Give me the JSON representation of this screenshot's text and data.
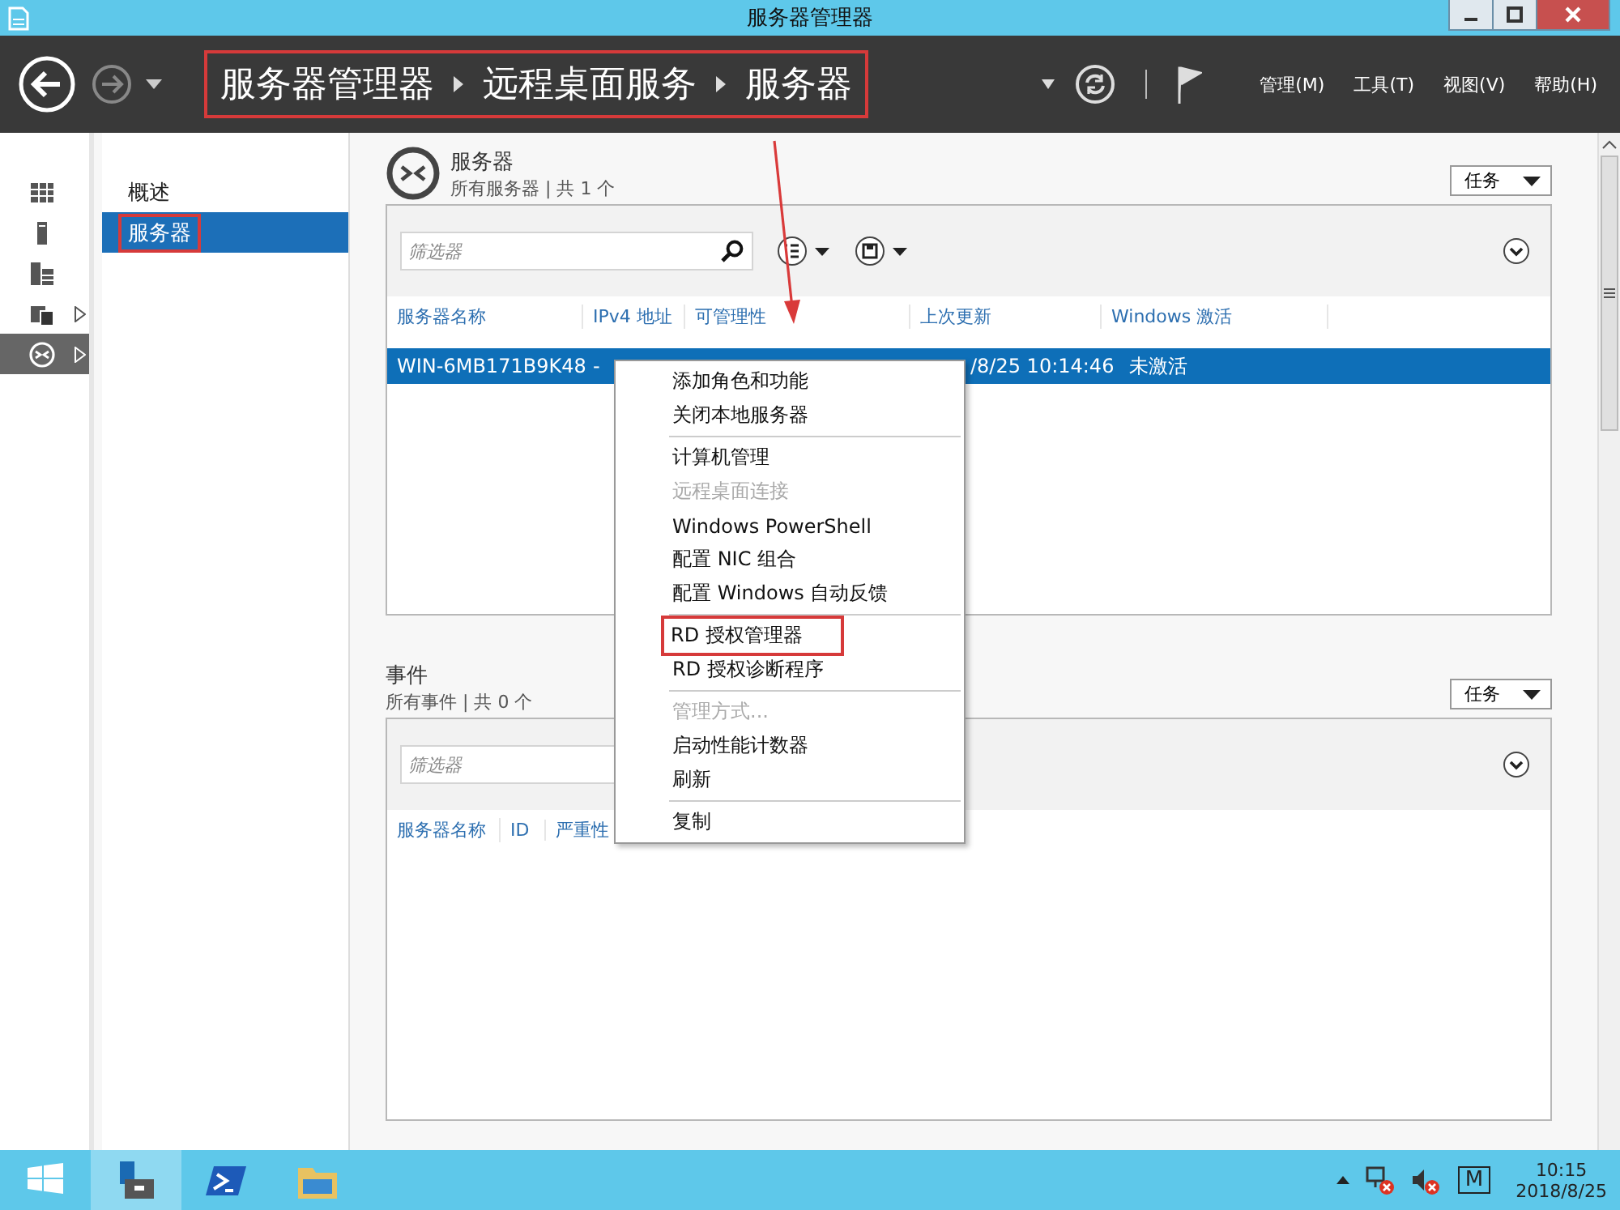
{
  "window": {
    "title": "服务器管理器"
  },
  "header": {
    "breadcrumb": [
      {
        "label": "服务器管理器"
      },
      {
        "label": "远程桌面服务"
      },
      {
        "label": "服务器"
      }
    ],
    "breadcrumb_annotated": true,
    "menus": [
      {
        "label": "管理(M)"
      },
      {
        "label": "工具(T)"
      },
      {
        "label": "视图(V)"
      },
      {
        "label": "帮助(H)"
      }
    ]
  },
  "rail": [
    {
      "selected": false,
      "expandable": false
    },
    {
      "selected": false,
      "expandable": false
    },
    {
      "selected": false,
      "expandable": false
    },
    {
      "selected": false,
      "expandable": true
    },
    {
      "selected": true,
      "expandable": true
    }
  ],
  "nav": [
    {
      "label": "概述",
      "selected": false,
      "annotated": false
    },
    {
      "label": "服务器",
      "selected": true,
      "annotated": true
    }
  ],
  "servers": {
    "title": "服务器",
    "subtitle": "所有服务器 | 共 1 个",
    "tasks": "任务",
    "filter": {
      "placeholder": "筛选器"
    },
    "columns": [
      "服务器名称",
      "IPv4 地址",
      "可管理性",
      "上次更新",
      "Windows 激活"
    ],
    "rows": [
      {
        "cells": [
          "WIN-6MB171B9K48",
          "-",
          "",
          "/8/25 10:14:46",
          "未激活"
        ],
        "selected": true
      }
    ]
  },
  "events": {
    "title": "事件",
    "subtitle": "所有事件 | 共 0 个",
    "tasks": "任务",
    "filter": {
      "placeholder": "筛选器"
    },
    "columns": [
      "服务器名称",
      "ID",
      "严重性"
    ]
  },
  "context_menu": [
    {
      "kind": "item",
      "label": "添加角色和功能",
      "disabled": false,
      "annotated": false
    },
    {
      "kind": "item",
      "label": "关闭本地服务器",
      "disabled": false,
      "annotated": false
    },
    {
      "kind": "separator"
    },
    {
      "kind": "item",
      "label": "计算机管理",
      "disabled": false,
      "annotated": false
    },
    {
      "kind": "item",
      "label": "远程桌面连接",
      "disabled": true,
      "annotated": false
    },
    {
      "kind": "item",
      "label": "Windows PowerShell",
      "disabled": false,
      "annotated": false
    },
    {
      "kind": "item",
      "label": "配置 NIC 组合",
      "disabled": false,
      "annotated": false
    },
    {
      "kind": "item",
      "label": "配置 Windows 自动反馈",
      "disabled": false,
      "annotated": false
    },
    {
      "kind": "separator"
    },
    {
      "kind": "item",
      "label": "RD 授权管理器",
      "disabled": false,
      "annotated": true
    },
    {
      "kind": "item",
      "label": "RD 授权诊断程序",
      "disabled": false,
      "annotated": false
    },
    {
      "kind": "separator"
    },
    {
      "kind": "item",
      "label": "管理方式...",
      "disabled": true,
      "annotated": false
    },
    {
      "kind": "item",
      "label": "启动性能计数器",
      "disabled": false,
      "annotated": false
    },
    {
      "kind": "item",
      "label": "刷新",
      "disabled": false,
      "annotated": false
    },
    {
      "kind": "separator"
    },
    {
      "kind": "item",
      "label": "复制",
      "disabled": false,
      "annotated": false
    }
  ],
  "taskbar": {
    "apps": [
      {
        "selected": false
      },
      {
        "selected": true
      },
      {
        "selected": false
      },
      {
        "selected": false
      }
    ],
    "tray": {
      "mark": "M",
      "time": "10:15",
      "date": "2018/8/25"
    }
  }
}
